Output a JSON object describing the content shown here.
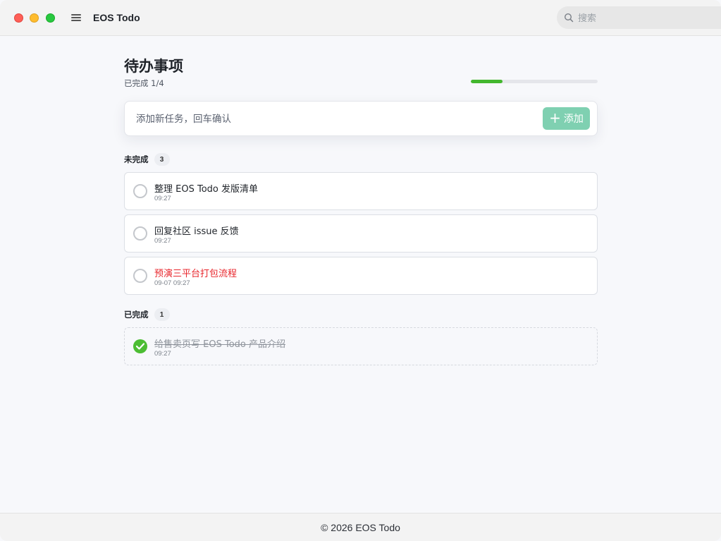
{
  "app": {
    "title": "EOS Todo"
  },
  "search": {
    "placeholder": "搜索"
  },
  "header": {
    "title": "待办事项",
    "progress_text": "已完成 1/4",
    "progress_value": 0.25
  },
  "add": {
    "placeholder": "添加新任务，回车确认",
    "button_label": "添加",
    "button_icon": "plus-icon"
  },
  "sections": {
    "pending": {
      "label": "未完成",
      "count": "3",
      "tasks": [
        {
          "title": "整理 EOS Todo 发版清单",
          "time": "09:27",
          "overdue": false
        },
        {
          "title": "回复社区 issue 反馈",
          "time": "09:27",
          "overdue": false
        },
        {
          "title": "预演三平台打包流程",
          "time": "09-07 09:27",
          "overdue": true
        }
      ]
    },
    "completed": {
      "label": "已完成",
      "count": "1",
      "tasks": [
        {
          "title": "给售卖页写 EOS Todo 产品介绍",
          "time": "09:27"
        }
      ]
    }
  },
  "footer": {
    "text": "© 2026 EOS Todo"
  },
  "colors": {
    "accent": "#43b72e",
    "add_button": "#7fd0b1",
    "overdue": "#e8262c",
    "done_check": "#4cbd33"
  }
}
